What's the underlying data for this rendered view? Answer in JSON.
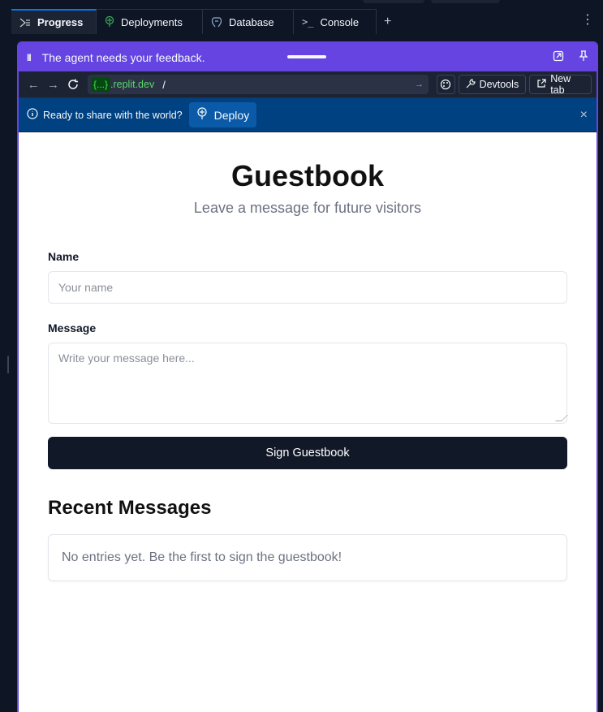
{
  "tabs": [
    {
      "label": "Progress",
      "icon": "progress-icon",
      "active": true,
      "close": "×"
    },
    {
      "label": "Deployments",
      "icon": "deployments-icon"
    },
    {
      "label": "Database",
      "icon": "database-icon"
    },
    {
      "label": "Console",
      "icon": "console-icon"
    }
  ],
  "tabbar": {
    "add": "+",
    "more": "⋮"
  },
  "feedback": {
    "text": "The agent needs your feedback.",
    "pause": "II"
  },
  "urlbar": {
    "host_pill": "{...}",
    "host_rest": ".replit.dev",
    "path": "/",
    "devtools": "Devtools",
    "new_tab": "New tab"
  },
  "deploybar": {
    "message": "Ready to share with the world?",
    "button": "Deploy",
    "close": "×"
  },
  "page": {
    "title": "Guestbook",
    "subtitle": "Leave a message for future visitors",
    "name_label": "Name",
    "name_placeholder": "Your name",
    "message_label": "Message",
    "message_placeholder": "Write your message here...",
    "submit": "Sign Guestbook",
    "recent_heading": "Recent Messages",
    "empty_text": "No entries yet. Be the first to sign the guestbook!"
  },
  "colors": {
    "accent": "#6544e1",
    "deploy_bar": "#004182",
    "url_green": "#58d66a",
    "tab_active": "#0079f2",
    "button_dark": "#111827"
  }
}
